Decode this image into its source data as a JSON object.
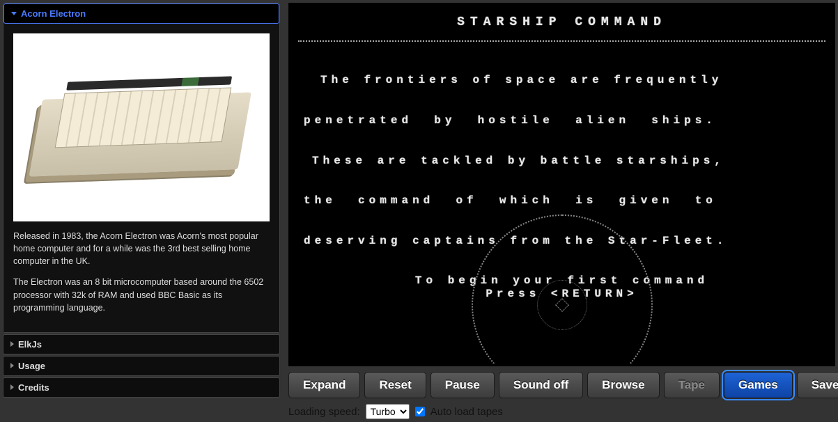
{
  "sidebar": {
    "sections": [
      {
        "title": "Acorn Electron",
        "expanded": true
      },
      {
        "title": "ElkJs",
        "expanded": false
      },
      {
        "title": "Usage",
        "expanded": false
      },
      {
        "title": "Credits",
        "expanded": false
      }
    ],
    "description_p1": "Released in 1983, the Acorn Electron was Acorn's most popular home computer and for a while was the 3rd best selling home computer in the UK.",
    "description_p2": "The Electron was an 8 bit microcomputer based around the 6502 processor with 32k of RAM and used BBC Basic as its programming language."
  },
  "screen": {
    "title": "STARSHIP  COMMAND",
    "intro_line1": "The frontiers of space are frequently",
    "intro_line2": "penetrated  by  hostile  alien  ships.",
    "intro_line3": "These are tackled by battle starships,",
    "intro_line4": "the  command  of  which  is  given  to",
    "intro_line5": "deserving captains from the Star-Fleet.",
    "intro_line6": "To begin your first command",
    "intro_line7": "Press <RETURN>"
  },
  "controls": {
    "expand": "Expand",
    "reset": "Reset",
    "pause": "Pause",
    "sound": "Sound off",
    "browse": "Browse",
    "tape": "Tape",
    "games": "Games",
    "save": "Save"
  },
  "bottom": {
    "speed_label": "Loading speed:",
    "speed_value": "Turbo",
    "speed_options": [
      "Turbo"
    ],
    "autoload_label": "Auto load tapes",
    "autoload_checked": true
  }
}
